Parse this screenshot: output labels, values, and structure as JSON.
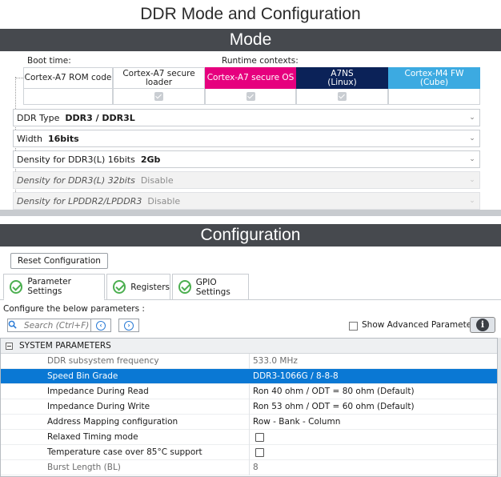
{
  "title": "DDR Mode and Configuration",
  "mode": {
    "header": "Mode",
    "boot_label": "Boot time:",
    "runtime_label": "Runtime contexts:",
    "contexts": [
      {
        "label": "Cortex-A7 ROM code",
        "style": "plain",
        "bg": "#ffffff",
        "color": "#222222"
      },
      {
        "label": "Cortex-A7 secure loader",
        "style": "plain",
        "bg": "#ffffff",
        "color": "#222222"
      },
      {
        "label": "Cortex-A7 secure OS",
        "style": "magenta",
        "bg": "#e6007e",
        "color": "#ffffff"
      },
      {
        "label": "A7NS",
        "sub": "(Linux)",
        "style": "navy",
        "bg": "#0b2258",
        "color": "#ffffff"
      },
      {
        "label": "Cortex-M4 FW",
        "sub": "(Cube)",
        "style": "cyan",
        "bg": "#3caae1",
        "color": "#ffffff"
      }
    ],
    "params": [
      {
        "label": "DDR Type",
        "value": "DDR3 / DDR3L",
        "disabled": false
      },
      {
        "label": "Width",
        "value": "16bits",
        "disabled": false
      },
      {
        "label": "Density for DDR3(L) 16bits",
        "value": "2Gb",
        "disabled": false
      },
      {
        "label": "Density for DDR3(L) 32bits",
        "value": "Disable",
        "disabled": true
      },
      {
        "label": "Density for LPDDR2/LPDDR3",
        "value": "Disable",
        "disabled": true
      }
    ]
  },
  "config": {
    "header": "Configuration",
    "reset_label": "Reset Configuration",
    "tabs": [
      {
        "label": "Parameter Settings"
      },
      {
        "label": "Registers"
      },
      {
        "label": "GPIO Settings"
      }
    ],
    "instruction": "Configure the below parameters :",
    "search_placeholder": "Search (Ctrl+F)",
    "show_advanced_label": "Show Advanced Parameters",
    "group_label": "SYSTEM PARAMETERS",
    "rows": [
      {
        "name": "DDR subsystem frequency",
        "value": "533.0 MHz",
        "kind": "grey"
      },
      {
        "name": "Speed Bin Grade",
        "value": "DDR3-1066G / 8-8-8",
        "kind": "selected"
      },
      {
        "name": "Impedance During Read",
        "value": "Ron 40 ohm / ODT = 80 ohm (Default)",
        "kind": "normal"
      },
      {
        "name": "Impedance During Write",
        "value": "Ron 53 ohm / ODT = 60 ohm (Default)",
        "kind": "normal"
      },
      {
        "name": "Address Mapping configuration",
        "value": "Row - Bank - Column",
        "kind": "normal"
      },
      {
        "name": "Relaxed Timing mode",
        "value": "",
        "kind": "checkbox"
      },
      {
        "name": "Temperature case over 85°C support",
        "value": "",
        "kind": "checkbox"
      },
      {
        "name": "Burst Length (BL)",
        "value": "8",
        "kind": "grey"
      }
    ]
  }
}
